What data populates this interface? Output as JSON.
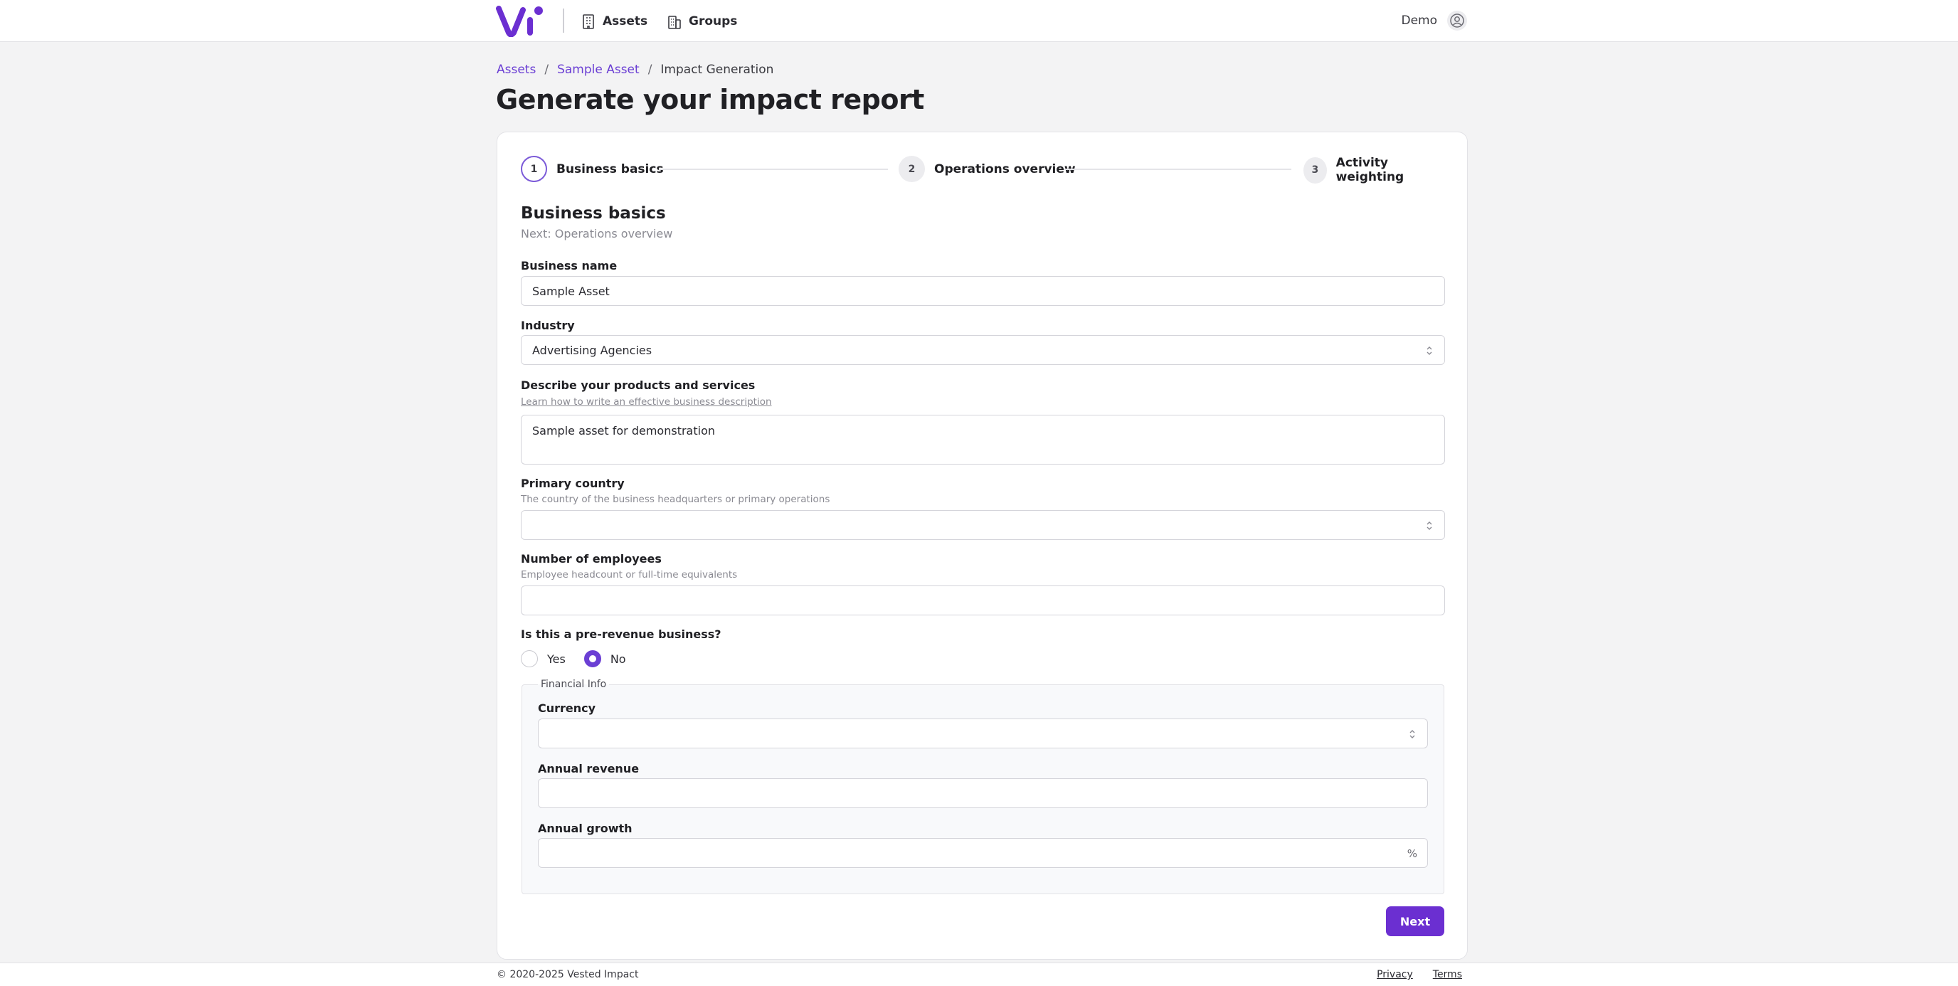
{
  "header": {
    "nav": [
      {
        "label": "Assets",
        "icon": "building-icon"
      },
      {
        "label": "Groups",
        "icon": "buildings-icon"
      }
    ],
    "user": {
      "name": "Demo",
      "icon": "user-circle-icon"
    },
    "brand_color": "#6b2fd1"
  },
  "breadcrumb": {
    "items": [
      "Assets",
      "Sample Asset"
    ],
    "current": "Impact Generation",
    "separator": "/"
  },
  "page": {
    "title": "Generate your impact report"
  },
  "stepper": {
    "steps": [
      {
        "number": "1",
        "label": "Business basics",
        "active": true
      },
      {
        "number": "2",
        "label": "Operations overview",
        "active": false
      },
      {
        "number": "3",
        "label": "Activity weighting",
        "active": false
      }
    ]
  },
  "form": {
    "section_title": "Business basics",
    "section_sub": "Next: Operations overview",
    "business_name": {
      "label": "Business name",
      "value": "Sample Asset"
    },
    "industry": {
      "label": "Industry",
      "value": "Advertising Agencies"
    },
    "description": {
      "label": "Describe your products and services",
      "help_link": "Learn how to write an effective business description",
      "value": "Sample asset for demonstration"
    },
    "primary_country": {
      "label": "Primary country",
      "help": "The country of the business headquarters or primary operations",
      "value": ""
    },
    "employees": {
      "label": "Number of employees",
      "help": "Employee headcount or full-time equivalents",
      "value": ""
    },
    "pre_revenue": {
      "label": "Is this a pre-revenue business?",
      "options": [
        "Yes",
        "No"
      ],
      "selected": "No"
    },
    "financial": {
      "legend": "Financial Info",
      "currency": {
        "label": "Currency",
        "value": ""
      },
      "annual_revenue": {
        "label": "Annual revenue",
        "value": ""
      },
      "annual_growth": {
        "label": "Annual growth",
        "value": "",
        "suffix": "%"
      }
    },
    "next_label": "Next"
  },
  "footer": {
    "copyright": "© 2020-2025 Vested Impact",
    "links": [
      "Privacy",
      "Terms"
    ]
  }
}
